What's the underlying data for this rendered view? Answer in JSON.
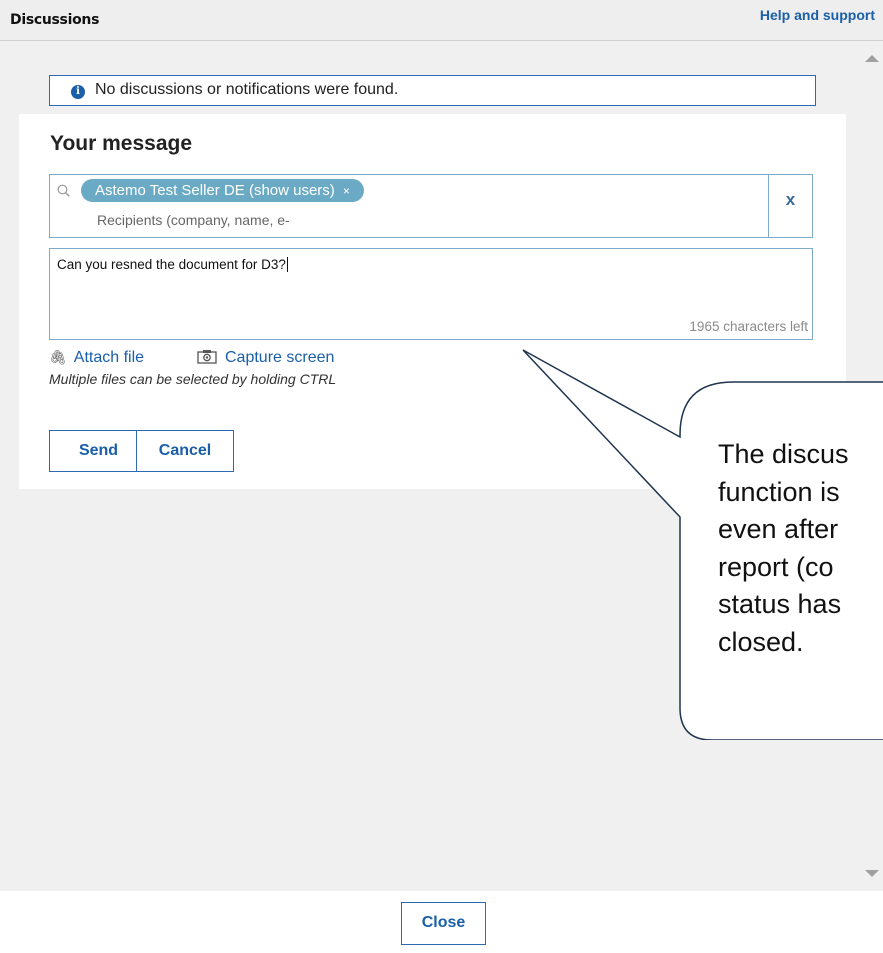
{
  "header": {
    "title": "Discussions",
    "help_label": "Help and support"
  },
  "notice": {
    "text": "No discussions or notifications were found.",
    "icon": "info-icon"
  },
  "message_form": {
    "title": "Your message",
    "recipient_chip": "Astemo Test Seller DE (show users)",
    "chip_remove": "×",
    "recipient_placeholder": "Recipients (company, name, e-",
    "clear_label": "x",
    "message_text": "Can you resned the document for D3?",
    "chars_left": "1965 characters left",
    "attach_label": "Attach file",
    "capture_label": "Capture screen",
    "hint": "Multiple files can be selected by holding CTRL",
    "send_label": "Send",
    "cancel_label": "Cancel"
  },
  "callout": {
    "lines": [
      "The discus",
      "function is",
      "even after",
      "report (co",
      "status has",
      "closed."
    ]
  },
  "footer": {
    "close_label": "Close"
  },
  "colors": {
    "accent": "#1a5fa8",
    "chip": "#6baac4",
    "border": "#7ea9c9"
  }
}
